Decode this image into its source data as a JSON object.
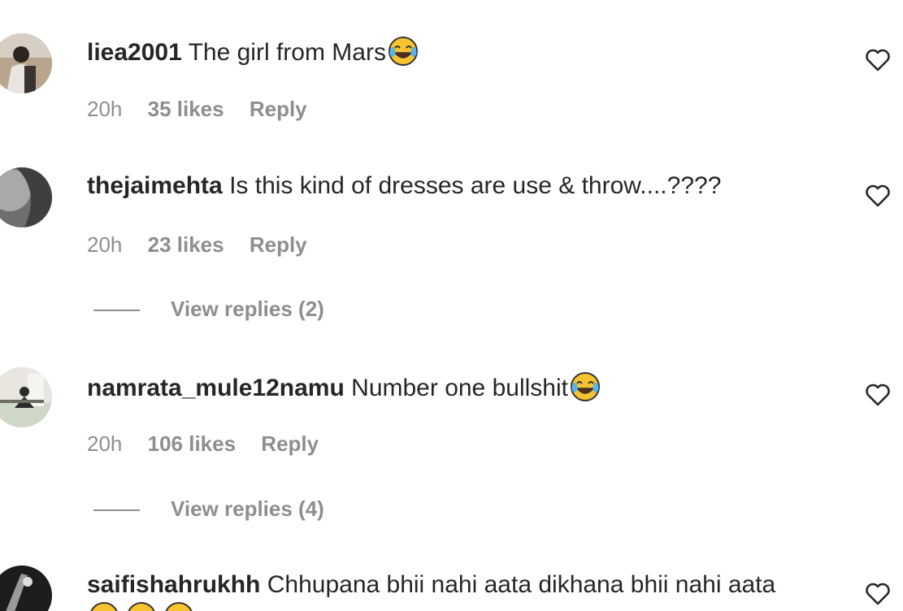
{
  "comments": [
    {
      "username": "liea2001",
      "text": "The girl from Mars",
      "emoji": "face-with-tears-of-joy",
      "time": "20h",
      "likes": "35 likes",
      "reply": "Reply"
    },
    {
      "username": "thejaimehta",
      "text": "Is this kind of dresses are use & throw....????",
      "time": "20h",
      "likes": "23 likes",
      "reply": "Reply",
      "view_replies": "View replies (2)"
    },
    {
      "username": "namrata_mule12namu",
      "text": "Number one bullshit",
      "emoji": "face-with-tears-of-joy",
      "time": "20h",
      "likes": "106 likes",
      "reply": "Reply",
      "view_replies": "View replies (4)"
    },
    {
      "username": "saifishahrukhh",
      "text": "Chhupana bhii nahi aata dikhana bhii nahi aata"
    }
  ],
  "colors": {
    "text": "#262626",
    "muted": "#8e8e8e",
    "emoji_face": "#f7c32e"
  },
  "icons": {
    "like": "heart-outline-icon"
  }
}
